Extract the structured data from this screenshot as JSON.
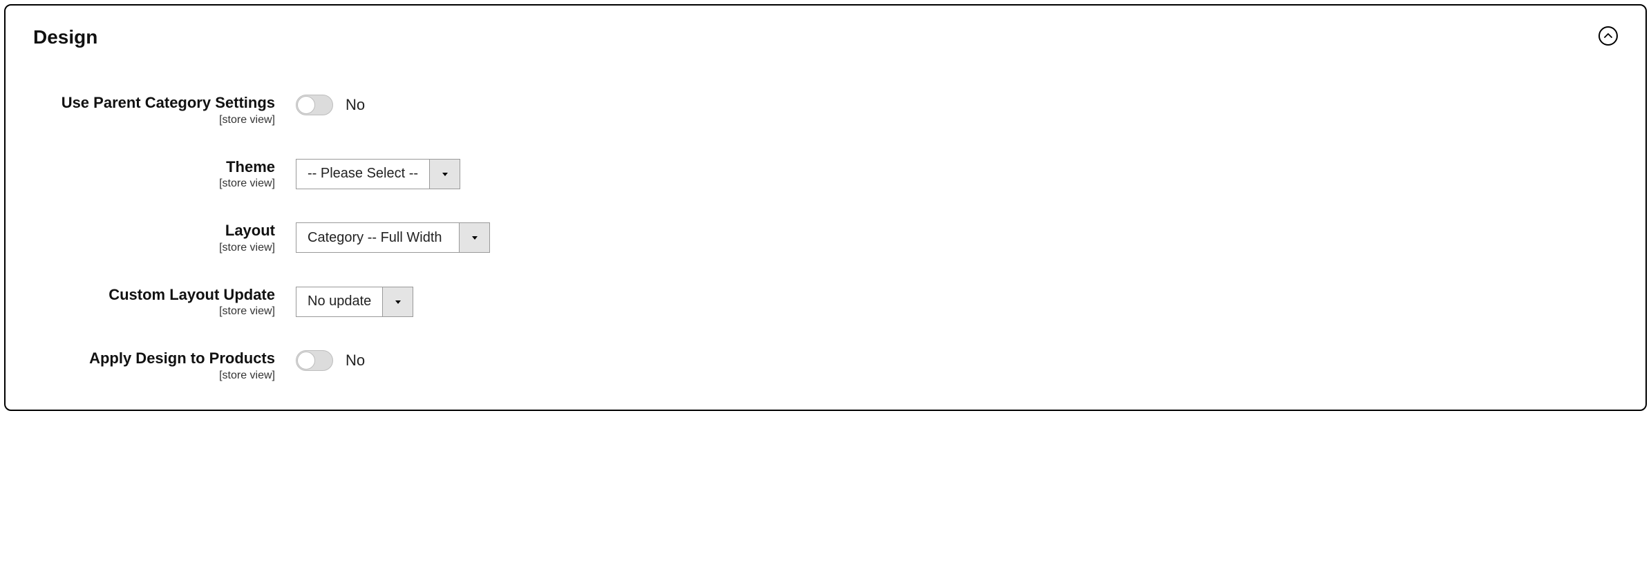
{
  "panel": {
    "title": "Design"
  },
  "scope_label": "[store view]",
  "fields": {
    "use_parent": {
      "label": "Use Parent Category Settings",
      "value_text": "No"
    },
    "theme": {
      "label": "Theme",
      "selected": "-- Please Select --"
    },
    "layout": {
      "label": "Layout",
      "selected": "Category -- Full Width"
    },
    "custom_layout_update": {
      "label": "Custom Layout Update",
      "selected": "No update"
    },
    "apply_to_products": {
      "label": "Apply Design to Products",
      "value_text": "No"
    }
  }
}
